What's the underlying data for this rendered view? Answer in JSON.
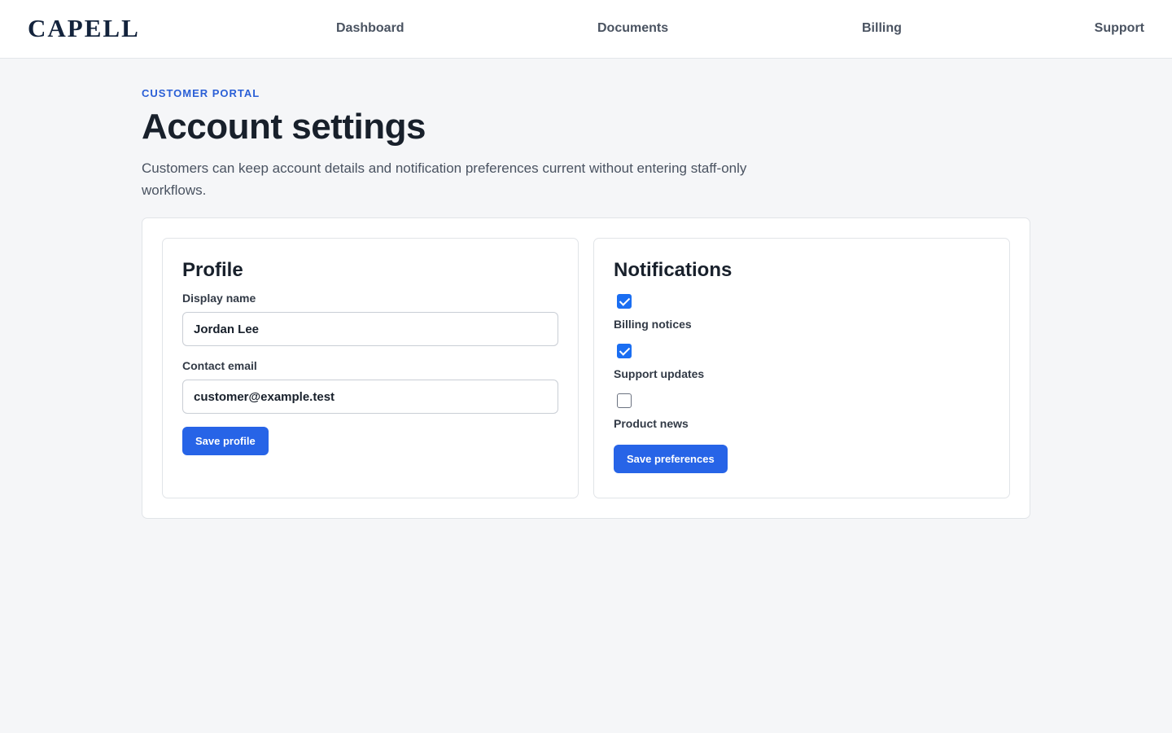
{
  "brand": {
    "name": "CAPELL"
  },
  "nav": {
    "items": [
      {
        "label": "Dashboard"
      },
      {
        "label": "Documents"
      },
      {
        "label": "Billing"
      },
      {
        "label": "Support"
      }
    ]
  },
  "page": {
    "eyebrow": "CUSTOMER PORTAL",
    "title": "Account settings",
    "description": "Customers can keep account details and notification preferences current without entering staff-only workflows."
  },
  "profile": {
    "title": "Profile",
    "display_name_label": "Display name",
    "display_name_value": "Jordan Lee",
    "contact_email_label": "Contact email",
    "contact_email_value": "customer@example.test",
    "save_label": "Save profile"
  },
  "notifications": {
    "title": "Notifications",
    "options": [
      {
        "label": "Billing notices",
        "checked": true
      },
      {
        "label": "Support updates",
        "checked": true
      },
      {
        "label": "Product news",
        "checked": false
      }
    ],
    "save_label": "Save preferences"
  },
  "colors": {
    "accent": "#2764e7",
    "eyebrow": "#2a5fd6",
    "background": "#f5f6f8",
    "brand": "#13233c"
  }
}
